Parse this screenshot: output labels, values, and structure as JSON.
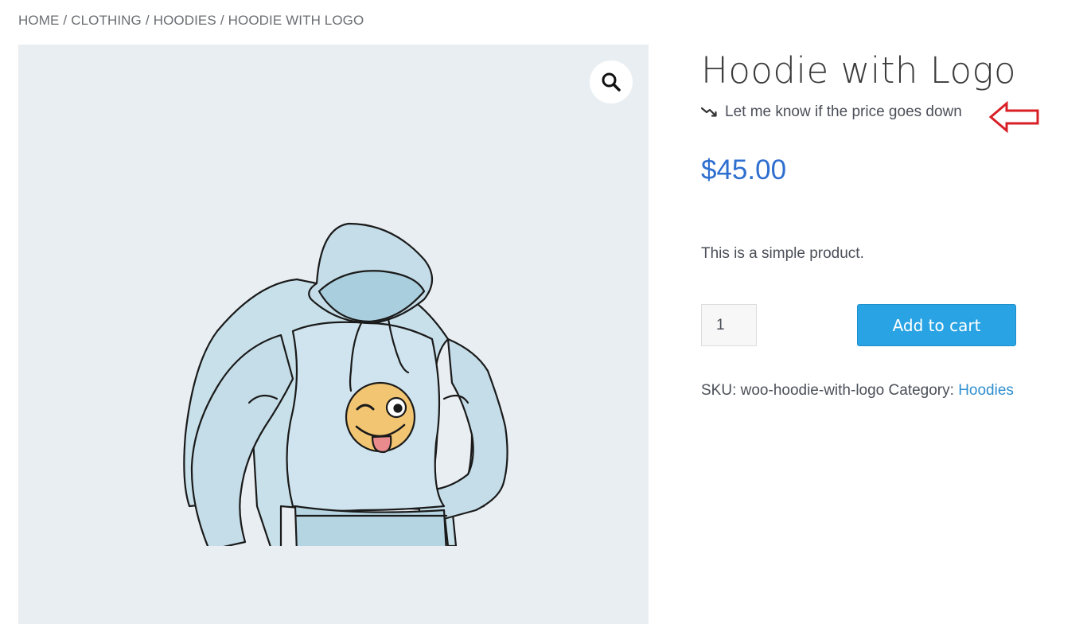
{
  "breadcrumb": {
    "items": [
      "HOME",
      "CLOTHING",
      "HOODIES"
    ],
    "current": "HOODIE WITH LOGO",
    "separator": "/"
  },
  "gallery": {
    "zoom_icon": "search-icon",
    "image": "hoodie-with-logo-illustration"
  },
  "product": {
    "title": "Hoodie with Logo",
    "price_alert_icon": "trending-down-icon",
    "price_alert_label": "Let me know if the price goes down",
    "annotation_icon": "red-arrow-left-icon",
    "price": "$45.00",
    "description": "This is a simple product.",
    "quantity": "1",
    "add_to_cart_label": "Add to cart",
    "sku_label": "SKU:",
    "sku_value": "woo-hoodie-with-logo",
    "category_label": "Category:",
    "category_value": "Hoodies"
  },
  "colors": {
    "price": "#2f6fd0",
    "button": "#2aa3e4",
    "link": "#2f8fd0",
    "gallery_bg": "#e9eef2",
    "annotation": "#d81f26"
  }
}
